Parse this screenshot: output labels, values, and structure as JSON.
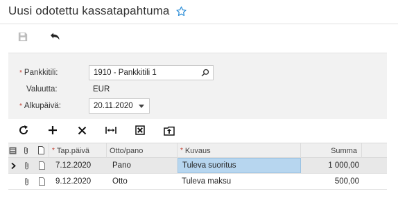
{
  "header": {
    "title": "Uusi odotettu kassatapahtuma",
    "favorite_icon": "star-outline-icon"
  },
  "toolbar": {
    "save_icon": "save-icon",
    "undo_icon": "undo-icon"
  },
  "form": {
    "bank_account": {
      "label": "Pankkitili:",
      "required": true,
      "value": "1910 - Pankkitili 1",
      "icon": "search-icon"
    },
    "currency": {
      "label": "Valuutta:",
      "required": false,
      "value": "EUR"
    },
    "start_date": {
      "label": "Alkupäivä:",
      "required": true,
      "value": "20.11.2020",
      "icon": "chevron-down-icon"
    }
  },
  "grid_toolbar": {
    "buttons": [
      "refresh-icon",
      "add-icon",
      "delete-icon",
      "fit-columns-icon",
      "clear-icon",
      "upload-icon"
    ]
  },
  "grid": {
    "columns": [
      {
        "key": "date",
        "label": "Tap.päivä",
        "required": true
      },
      {
        "key": "type",
        "label": "Otto/pano",
        "required": false
      },
      {
        "key": "desc",
        "label": "Kuvaus",
        "required": true
      },
      {
        "key": "amount",
        "label": "Summa",
        "required": false
      }
    ],
    "rows": [
      {
        "date": "7.12.2020",
        "type": "Pano",
        "desc": "Tuleva suoritus",
        "amount": "1 000,00",
        "active": true
      },
      {
        "date": "9.12.2020",
        "type": "Otto",
        "desc": "Tuleva maksu",
        "amount": "500,00",
        "active": false
      }
    ]
  },
  "colors": {
    "accent_blue": "#2f8fd8",
    "required_red": "#c0392b",
    "selected_cell": "#b7d6ef",
    "panel_bg": "#f2f2f2"
  }
}
